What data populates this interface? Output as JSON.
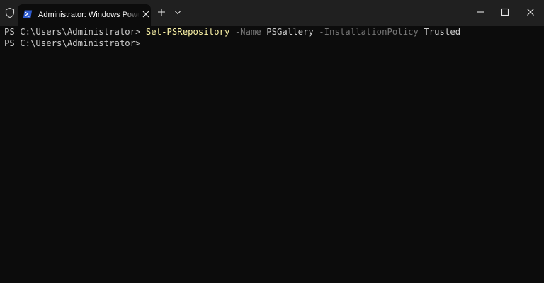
{
  "colors": {
    "titlebar": "#202020",
    "terminal_background": "#0c0c0c",
    "text": "#cccccc",
    "command": "#f9f1a5",
    "parameter": "#767676",
    "powershell_blue": "#2f5ccf"
  },
  "titlebar": {
    "admin_icon": "shield-icon",
    "tab": {
      "icon": "powershell-icon",
      "title": "Administrator: Windows PowerShell",
      "close_icon": "close-icon"
    },
    "new_tab_icon": "plus-icon",
    "dropdown_icon": "chevron-down-icon",
    "window_controls": {
      "minimize_icon": "minimize-icon",
      "maximize_icon": "maximize-icon",
      "close_icon": "close-icon"
    }
  },
  "terminal": {
    "line1": {
      "prompt": "PS C:\\Users\\Administrator> ",
      "command": "Set-PSRepository",
      "param1": "-Name",
      "value1": "PSGallery",
      "param2": "-InstallationPolicy",
      "value2": "Trusted"
    },
    "line2": {
      "prompt": "PS C:\\Users\\Administrator> "
    }
  }
}
